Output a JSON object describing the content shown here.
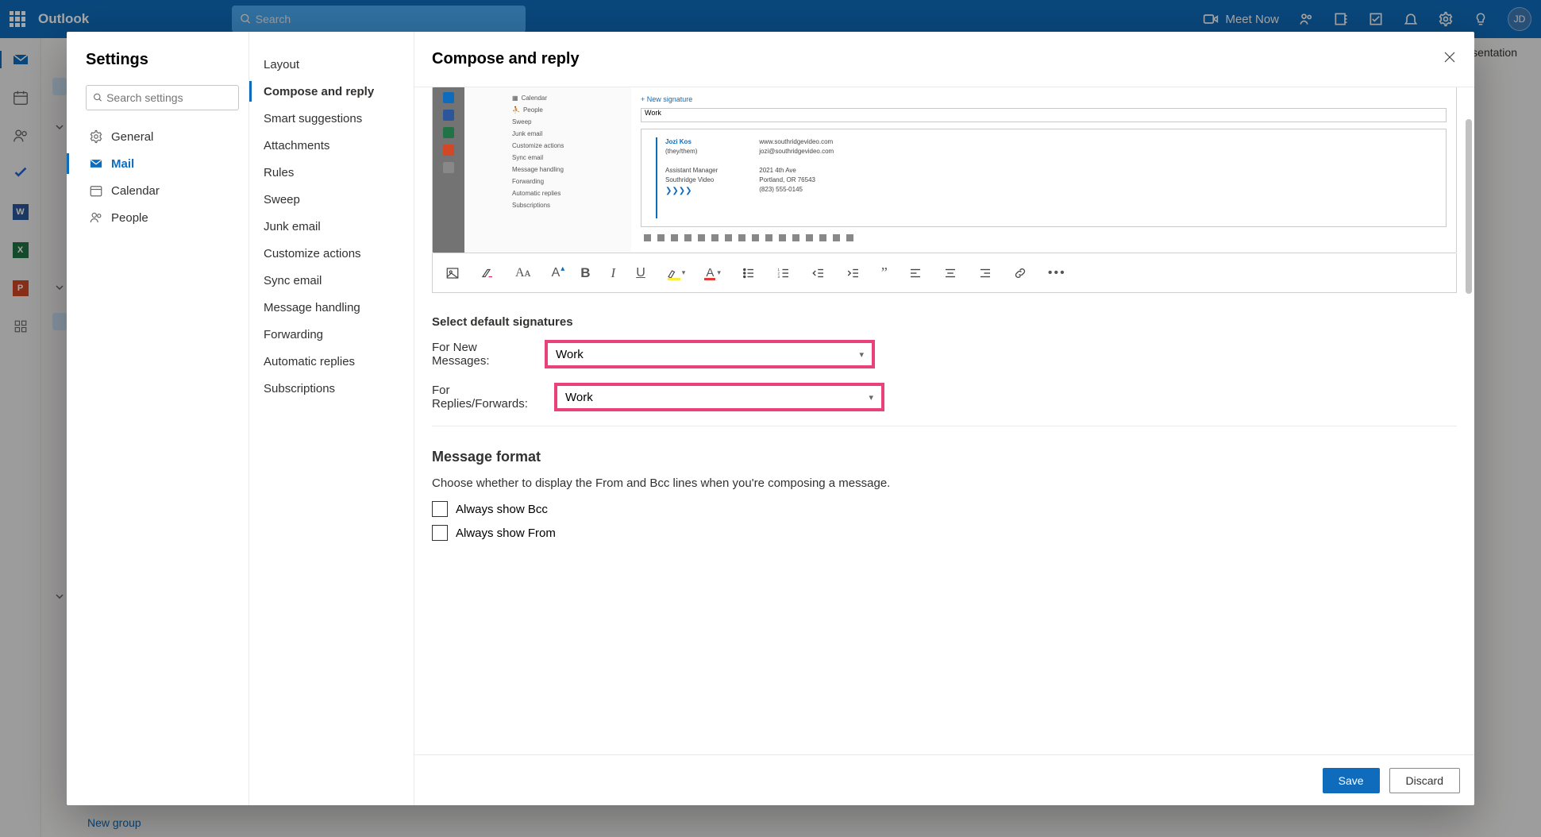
{
  "topbar": {
    "brand": "Outlook",
    "search_placeholder": "Search",
    "meet_now": "Meet Now",
    "avatar_initials": "JD"
  },
  "background": {
    "new_group": "New group",
    "presentation_suffix": "sentation"
  },
  "settings": {
    "title": "Settings",
    "search_placeholder": "Search settings",
    "categories": [
      {
        "label": "General"
      },
      {
        "label": "Mail"
      },
      {
        "label": "Calendar"
      },
      {
        "label": "People"
      }
    ],
    "subcategories": [
      "Layout",
      "Compose and reply",
      "Smart suggestions",
      "Attachments",
      "Rules",
      "Sweep",
      "Junk email",
      "Customize actions",
      "Sync email",
      "Message handling",
      "Forwarding",
      "Automatic replies",
      "Subscriptions"
    ]
  },
  "panel": {
    "title": "Compose and reply",
    "preview": {
      "new_signature": "+  New signature",
      "signature_name": "Work",
      "mini_items": [
        "Calendar",
        "People",
        "Sweep",
        "Junk email",
        "Customize actions",
        "Sync email",
        "Message handling",
        "Forwarding",
        "Automatic replies",
        "Subscriptions"
      ],
      "sig_name": "Jozi Kos",
      "sig_pronoun": "(they/them)",
      "sig_role": "Assistant Manager",
      "sig_company": "Southridge Video",
      "sig_site": "www.southridgevideo.com",
      "sig_email": "jozi@southridgevideo.com",
      "sig_addr1": "2021 4th Ave",
      "sig_addr2": "Portland, OR 76543",
      "sig_phone": "(823) 555-0145"
    },
    "defaults": {
      "heading": "Select default signatures",
      "new_label": "For New Messages:",
      "new_value": "Work",
      "reply_label": "For Replies/Forwards:",
      "reply_value": "Work"
    },
    "format": {
      "heading": "Message format",
      "desc": "Choose whether to display the From and Bcc lines when you're composing a message.",
      "bcc": "Always show Bcc",
      "from": "Always show From"
    },
    "footer": {
      "save": "Save",
      "discard": "Discard"
    }
  }
}
